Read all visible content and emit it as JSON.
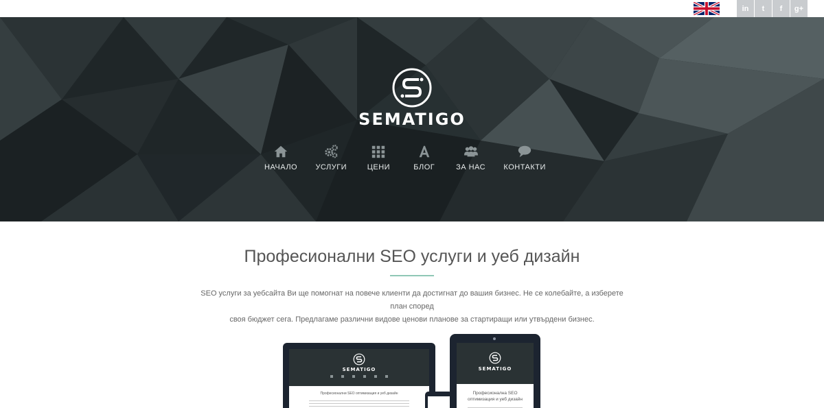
{
  "header": {
    "language_flag": "uk-flag-icon",
    "social": [
      {
        "name": "linkedin-icon",
        "glyph": "in"
      },
      {
        "name": "twitter-icon",
        "glyph": "t"
      },
      {
        "name": "facebook-icon",
        "glyph": "f"
      },
      {
        "name": "google-plus-icon",
        "glyph": "g+"
      }
    ]
  },
  "hero": {
    "logo_text": "SEMATIGO",
    "nav": [
      {
        "label": "НАЧАЛО",
        "icon": "home-icon"
      },
      {
        "label": "УСЛУГИ",
        "icon": "gears-icon"
      },
      {
        "label": "ЦЕНИ",
        "icon": "grid-icon"
      },
      {
        "label": "БЛОГ",
        "icon": "font-icon"
      },
      {
        "label": "ЗА НАС",
        "icon": "users-icon"
      },
      {
        "label": "КОНТАКТИ",
        "icon": "comment-icon"
      }
    ]
  },
  "main": {
    "title": "Професионални SEO услуги и уеб дизайн",
    "intro_line1": "SEO услуги за уебсайта Ви ще помогнат на повече клиенти да достигнат до вашия бизнес. Не се колебайте, а изберете план според",
    "intro_line2": "своя бюджет сега. Предлагаме различни видове ценови планове за стартиращи или утвърдени бизнес."
  },
  "devices": {
    "laptop_logo": "SEMATIGO",
    "laptop_title": "Професионални SEO оптимизация и уеб дизайн",
    "tablet_logo": "SEMATIGO",
    "tablet_title": "Професионална SEO оптимизация и уеб дизайн"
  },
  "colors": {
    "accent": "#8fc7b5",
    "hero_bg": "#1f2628",
    "device": "#1c2430",
    "social_bg": "#c9cccf"
  }
}
